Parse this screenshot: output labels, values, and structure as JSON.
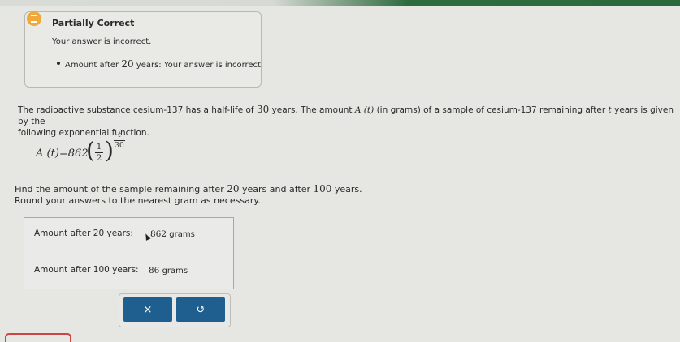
{
  "feedback": {
    "title": "Partially Correct",
    "message": "Your answer is incorrect.",
    "bullet_prefix": "Amount after ",
    "bullet_number": "20",
    "bullet_suffix": " years: Your answer is incorrect."
  },
  "problem": {
    "line1_a": "The radioactive substance cesium-137 has a half-life of ",
    "half_life": "30",
    "line1_b": " years. The amount ",
    "amount_func": "A (t)",
    "line1_c": " (in grams) of a sample of cesium-137 remaining after ",
    "t_var": "t",
    "line1_d": " years is given by the",
    "line2": "following exponential function."
  },
  "formula": {
    "lhs": "A (t)=862",
    "base_num": "1",
    "base_den": "2",
    "exp_num": "t",
    "exp_den": "30"
  },
  "task": {
    "line1_a": "Find the amount of the sample remaining after ",
    "years1": "20",
    "line1_b": " years and after ",
    "years2": "100",
    "line1_c": " years.",
    "line2": "Round your answers to the nearest gram as necessary."
  },
  "answers": {
    "row1_label": "Amount after 20 years:",
    "row1_value": "862",
    "row1_unit": "grams",
    "row2_label": "Amount after 100 years:",
    "row2_value": "86",
    "row2_unit": "grams"
  },
  "buttons": {
    "clear": "×",
    "undo": "↺"
  },
  "colors": {
    "feedback_icon": "#f0a83a",
    "button": "#1f5f8f",
    "top_accent": "#2e6b3e"
  }
}
